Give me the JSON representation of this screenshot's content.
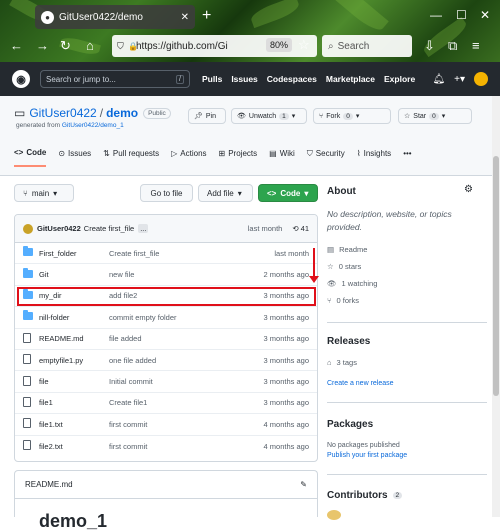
{
  "browser": {
    "tab_title": "GitUser0422/demo",
    "url": "https://github.com/Gi",
    "zoom": "80%",
    "search_placeholder": "Search"
  },
  "gh_header": {
    "search_placeholder": "Search or jump to...",
    "search_shortcut": "/",
    "nav": [
      "Pulls",
      "Issues",
      "Codespaces",
      "Marketplace",
      "Explore"
    ]
  },
  "repo": {
    "owner": "GitUser0422",
    "separator": "/",
    "name": "demo",
    "visibility": "Public",
    "generated_from_label": "generated from",
    "generated_from_link": "GitUser0422/demo_1",
    "pin_label": "Pin",
    "unwatch_label": "Unwatch",
    "unwatch_count": "1",
    "fork_label": "Fork",
    "fork_count": "0",
    "star_label": "Star",
    "star_count": "0"
  },
  "repo_tabs": [
    {
      "label": "Code",
      "icon": "code-icon"
    },
    {
      "label": "Issues",
      "icon": "issue-icon"
    },
    {
      "label": "Pull requests",
      "icon": "pull-request-icon"
    },
    {
      "label": "Actions",
      "icon": "play-icon"
    },
    {
      "label": "Projects",
      "icon": "table-icon"
    },
    {
      "label": "Wiki",
      "icon": "book-icon"
    },
    {
      "label": "Security",
      "icon": "shield-icon"
    },
    {
      "label": "Insights",
      "icon": "graph-icon"
    }
  ],
  "toolbar": {
    "branch": "main",
    "go_to_file": "Go to file",
    "add_file": "Add file",
    "code": "Code"
  },
  "latest_commit": {
    "user": "GitUser0422",
    "message": "Create first_file",
    "ellipsis": "...",
    "time": "last month",
    "count": "41"
  },
  "files": [
    {
      "name": "First_folder",
      "commit": "Create first_file",
      "time": "last month",
      "type": "folder"
    },
    {
      "name": "Git",
      "commit": "new file",
      "time": "2 months ago",
      "type": "folder"
    },
    {
      "name": "my_dir",
      "commit": "add file2",
      "time": "3 months ago",
      "type": "folder"
    },
    {
      "name": "nill-folder",
      "commit": "commit empty folder",
      "time": "3 months ago",
      "type": "folder"
    },
    {
      "name": "README.md",
      "commit": "file added",
      "time": "3 months ago",
      "type": "file"
    },
    {
      "name": "emptyfile1.py",
      "commit": "one file added",
      "time": "3 months ago",
      "type": "file"
    },
    {
      "name": "file",
      "commit": "Initial commit",
      "time": "3 months ago",
      "type": "file"
    },
    {
      "name": "file1",
      "commit": "Create file1",
      "time": "3 months ago",
      "type": "file"
    },
    {
      "name": "file1.txt",
      "commit": "first commit",
      "time": "4 months ago",
      "type": "file"
    },
    {
      "name": "file2.txt",
      "commit": "first commit",
      "time": "4 months ago",
      "type": "file"
    }
  ],
  "readme": {
    "filename": "README.md",
    "heading": "demo_1"
  },
  "about": {
    "title": "About",
    "description": "No description, website, or topics provided.",
    "readme": "Readme",
    "stars": "0 stars",
    "watching": "1 watching",
    "forks": "0 forks"
  },
  "releases": {
    "title": "Releases",
    "tags": "3 tags",
    "create_link": "Create a new release"
  },
  "packages": {
    "title": "Packages",
    "none": "No packages published",
    "publish_link": "Publish your first package"
  },
  "contributors": {
    "title": "Contributors",
    "count": "2"
  },
  "colors": {
    "highlight": "#e0101a",
    "code_button": "#2da44e",
    "link": "#0969da"
  }
}
